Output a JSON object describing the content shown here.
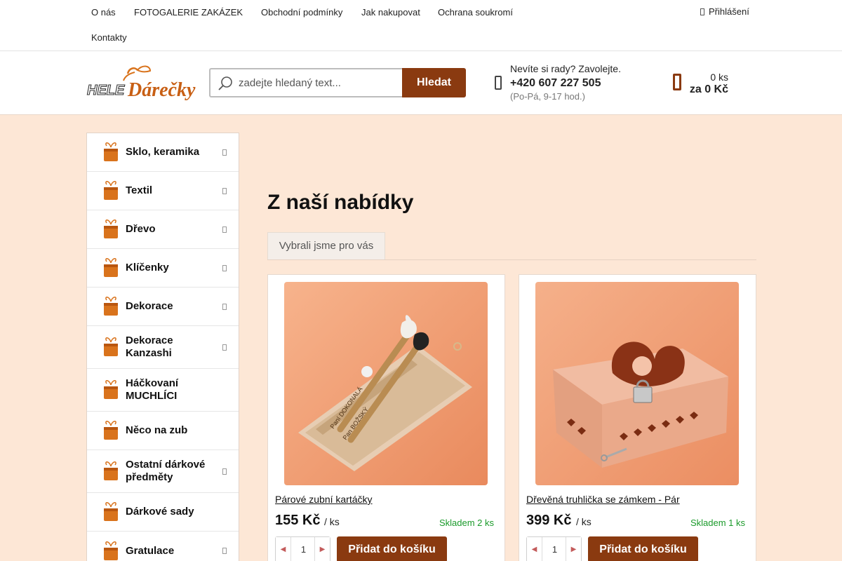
{
  "topnav": {
    "links": [
      "O nás",
      "FOTOGALERIE ZAKÁZEK",
      "Obchodní podmínky",
      "Jak nakupovat",
      "Ochrana soukromí",
      "Kontakty"
    ],
    "login": "Přihlášení"
  },
  "header": {
    "logo": {
      "word1": "HELE",
      "word2": "Dárečky"
    },
    "search": {
      "placeholder": "zadejte hledaný text...",
      "button": "Hledat"
    },
    "contact": {
      "question": "Nevíte si rady? Zavolejte.",
      "phone": "+420 607 227 505",
      "hours": "(Po-Pá, 9-17 hod.)"
    },
    "cart": {
      "count": "0 ks",
      "total": "za 0 Kč"
    }
  },
  "sidebar": {
    "categories": [
      {
        "label": "Sklo, keramika",
        "has_sub": true
      },
      {
        "label": "Textil",
        "has_sub": true
      },
      {
        "label": "Dřevo",
        "has_sub": true
      },
      {
        "label": "Klíčenky",
        "has_sub": true
      },
      {
        "label": "Dekorace",
        "has_sub": true
      },
      {
        "label": "Dekorace Kanzashi",
        "has_sub": true
      },
      {
        "label": "Háčkovaní MUCHLÍCI",
        "has_sub": false
      },
      {
        "label": "Něco na zub",
        "has_sub": false
      },
      {
        "label": "Ostatní dárkové předměty",
        "has_sub": true
      },
      {
        "label": "Dárkové sady",
        "has_sub": false
      },
      {
        "label": "Gratulace",
        "has_sub": true
      }
    ]
  },
  "main": {
    "heading": "Z naší nabídky",
    "tab": "Vybrali jsme pro vás",
    "products": [
      {
        "name": "Párové zubní kartáčky",
        "price": "155 Kč",
        "unit": "/ ks",
        "stock": "Skladem 2 ks",
        "qty": "1",
        "add": "Přidat do košíku",
        "engraving": [
          "Paní DOKONALÁ",
          "Pan BOŽSKÝ"
        ]
      },
      {
        "name": "Dřevěná truhlička se zámkem - Pár",
        "price": "399 Kč",
        "unit": "/ ks",
        "stock": "Skladem 1 ks",
        "qty": "1",
        "add": "Přidat do košíku"
      }
    ]
  },
  "colors": {
    "accent": "#8a3a10",
    "page_bg": "#fde7d6",
    "stock_green": "#1a9a2a"
  }
}
